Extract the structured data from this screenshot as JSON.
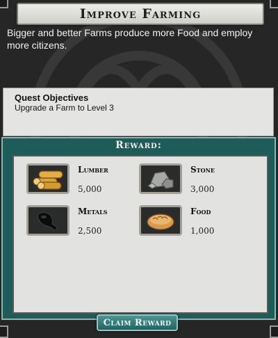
{
  "quest": {
    "title": "Improve Farming",
    "description": "Bigger and better Farms produce more Food and employ more citizens."
  },
  "objectives": {
    "header": "Quest Objectives",
    "items": [
      "Upgrade a Farm to Level 3"
    ]
  },
  "reward": {
    "title": "Reward:",
    "items": [
      {
        "name": "Lumber",
        "quantity": "5,000",
        "icon": "lumber-icon"
      },
      {
        "name": "Stone",
        "quantity": "3,000",
        "icon": "stone-icon"
      },
      {
        "name": "Metals",
        "quantity": "2,500",
        "icon": "metals-icon"
      },
      {
        "name": "Food",
        "quantity": "1,000",
        "icon": "food-icon"
      }
    ]
  },
  "actions": {
    "claim_label": "Claim Reward"
  },
  "colors": {
    "background": "#262626",
    "reward_panel": "#1e5c5a",
    "button": "#2e7876",
    "banner": "#e0e0dc"
  }
}
